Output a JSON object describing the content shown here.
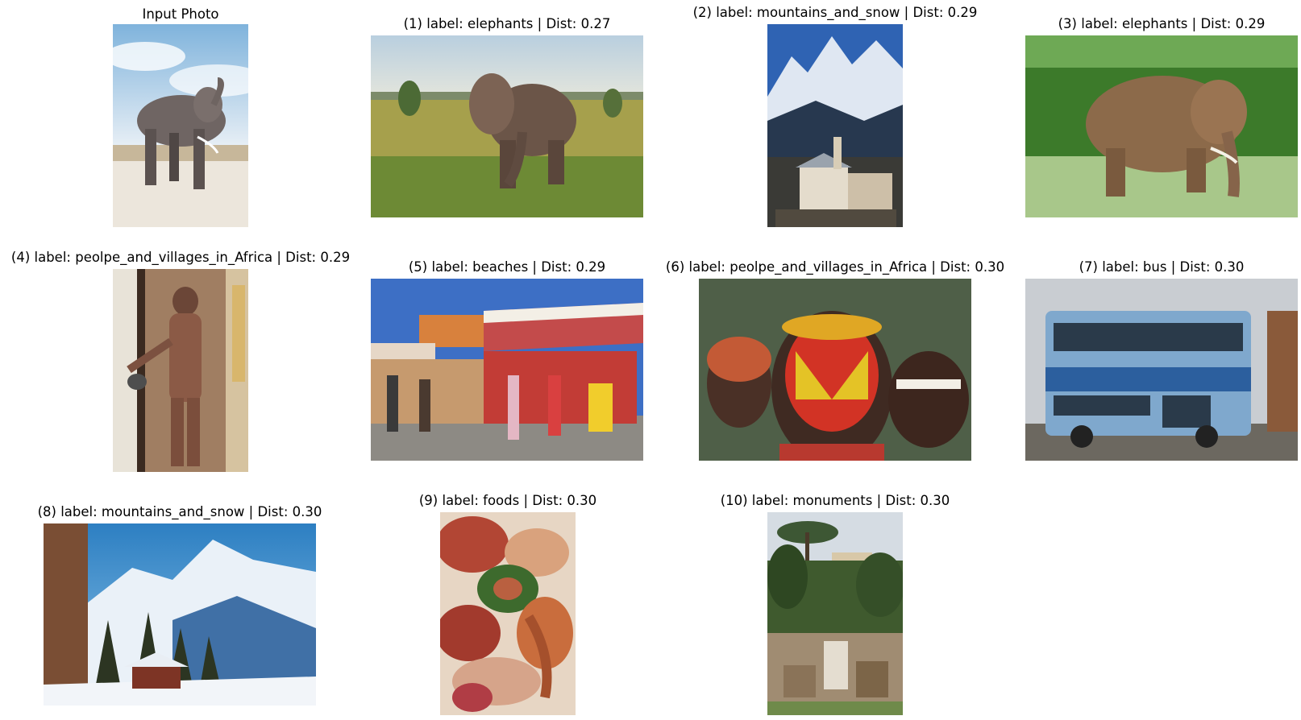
{
  "figure": {
    "input": {
      "title": "Input Photo",
      "scene": "elephant-on-beach"
    },
    "results": [
      {
        "title": "(1) label: elephants | Dist: 0.27",
        "scene": "elephant-savanna"
      },
      {
        "title": "(2) label: mountains_and_snow | Dist: 0.29",
        "scene": "alpine-village"
      },
      {
        "title": "(3) label: elephants | Dist: 0.29",
        "scene": "elephant-forest"
      },
      {
        "title": "(4) label: peolpe_and_villages_in_Africa | Dist: 0.29",
        "scene": "man-at-doorway"
      },
      {
        "title": "(5) label: beaches | Dist: 0.29",
        "scene": "carousel-fair"
      },
      {
        "title": "(6) label: peolpe_and_villages_in_Africa | Dist: 0.30",
        "scene": "painted-faces"
      },
      {
        "title": "(7) label: bus | Dist: 0.30",
        "scene": "double-decker-bus"
      },
      {
        "title": "(8) label: mountains_and_snow | Dist: 0.30",
        "scene": "snowy-mountain-chalet"
      },
      {
        "title": "(9) label: foods | Dist: 0.30",
        "scene": "food-platter"
      },
      {
        "title": "(10) label: monuments | Dist: 0.30",
        "scene": "ancient-ruins"
      }
    ]
  }
}
